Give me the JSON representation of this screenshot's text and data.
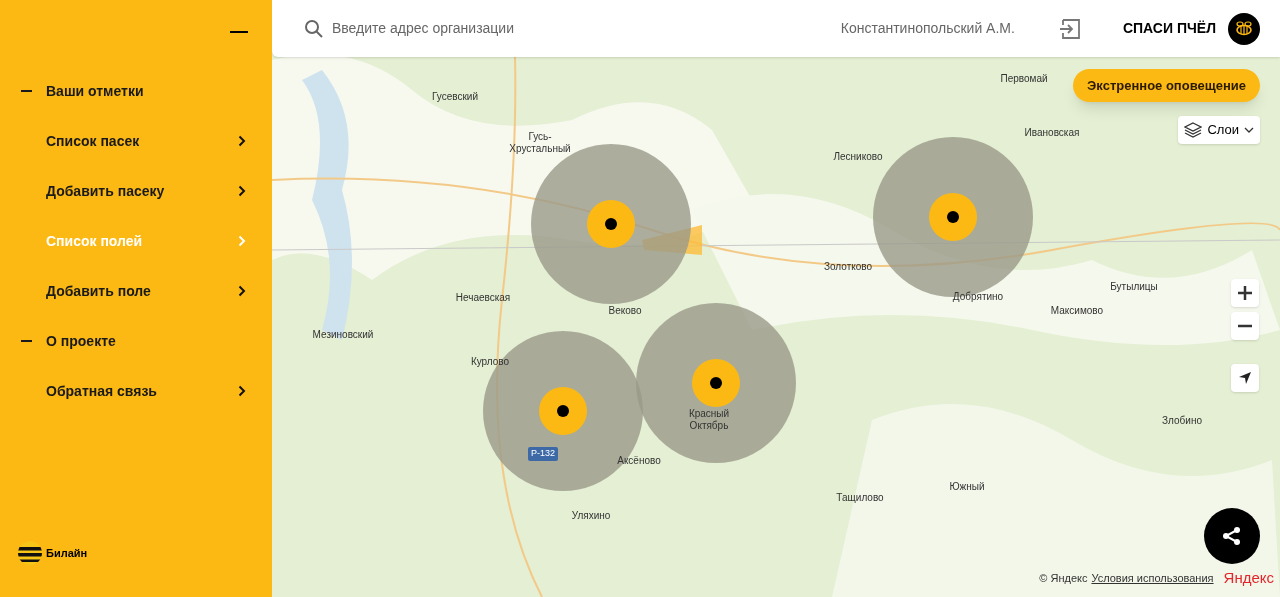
{
  "sidebar": {
    "menu_items": [
      {
        "kind": "section",
        "label": "Ваши отметки",
        "selected": false
      },
      {
        "kind": "link",
        "label": "Список пасек",
        "selected": false
      },
      {
        "kind": "link",
        "label": "Добавить пасеку",
        "selected": false
      },
      {
        "kind": "link",
        "label": "Список полей",
        "selected": true
      },
      {
        "kind": "link",
        "label": "Добавить поле",
        "selected": false
      },
      {
        "kind": "section",
        "label": "О проекте",
        "selected": false
      },
      {
        "kind": "link",
        "label": "Обратная связь",
        "selected": false
      }
    ],
    "brand": "Билайн"
  },
  "header": {
    "search": {
      "placeholder": "Введите адрес организации"
    },
    "user_name": "Константинопольский А.М.",
    "project_title": "СПАСИ ПЧЁЛ"
  },
  "map": {
    "alert_button": "Экстренное оповещение",
    "layers_button": "Слои",
    "road_badge": "Р-132",
    "places": [
      "Гусевский",
      "Гусь-\nХрустальный",
      "Первомай",
      "Ивановская",
      "Лесниково",
      "Золотково",
      "Добрятино",
      "Бутылицы",
      "Максимово",
      "Нечаевская",
      "Веково",
      "Мезиновский",
      "Курлово",
      "Красный\nОктябрь",
      "Аксёново",
      "Уляхино",
      "Тащилово",
      "Южный",
      "Злобино"
    ],
    "copyright": "© Яндекс",
    "terms_link": "Условия использования",
    "logo": "Яндекс"
  }
}
